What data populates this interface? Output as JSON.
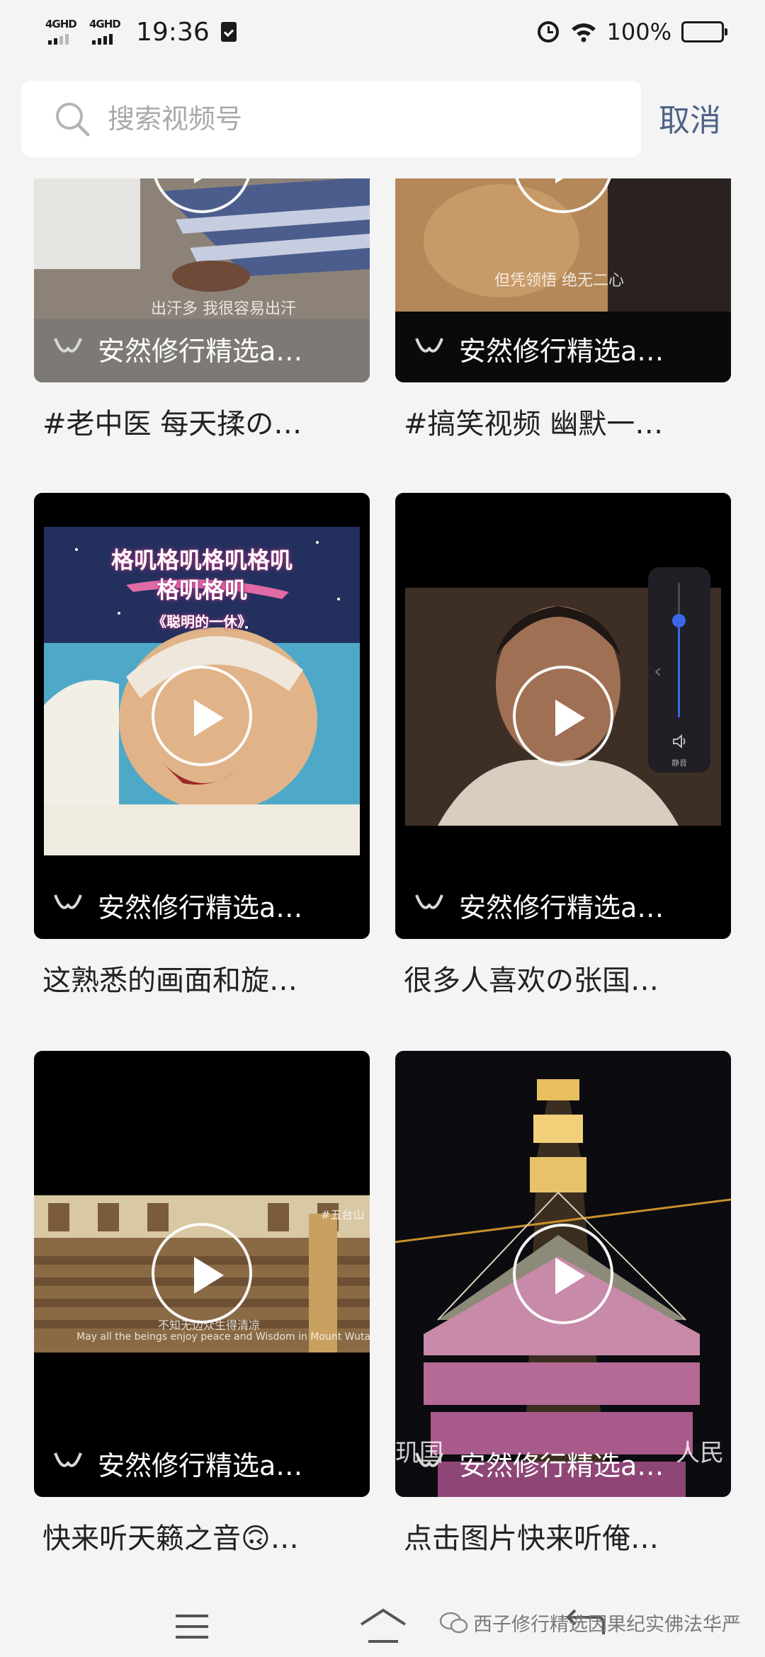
{
  "status_bar": {
    "network_1": "4GHD",
    "network_2": "4GHD",
    "time": "19:36",
    "battery_percent": "100%",
    "battery_level": 1.0,
    "icons": [
      "signal-icon",
      "clipboard-check-icon",
      "alarm-icon",
      "wifi-icon",
      "battery-icon"
    ]
  },
  "search": {
    "placeholder": "搜索视频号",
    "value": "",
    "cancel_label": "取消"
  },
  "results": [
    {
      "author": "安然修行精选a…",
      "title": "#老中医 每天揉の…",
      "caption": "出汗多  我很容易出汗"
    },
    {
      "author": "安然修行精选a…",
      "title": "#搞笑视频 幽默一…",
      "caption": "但凭领悟  绝无二心"
    },
    {
      "author": "安然修行精选a…",
      "title": "这熟悉的画面和旋…",
      "banner_line1": "格叽格叽格叽格叽",
      "banner_line2": "格叽格叽",
      "banner_line3": "《聪明的一休》"
    },
    {
      "author": "安然修行精选a…",
      "title": "很多人喜欢の张国…",
      "volume_label": "静音",
      "volume_level": 0.72
    },
    {
      "author": "安然修行精选a…",
      "title": "快来听天籁之音🙃…",
      "caption_cn": "不知无边众生得清凉",
      "caption_en": "May all the beings enjoy peace and Wisdom in Mount Wutai",
      "tag": "#五台山"
    },
    {
      "author": "安然修行精选a…",
      "title": "点击图片快来听俺…",
      "overlay_left": "玑国",
      "overlay_right": "人民"
    }
  ],
  "watermark": {
    "text": "西子修行精选因果纪实佛法华严"
  },
  "colors": {
    "accent": "#4f6386",
    "volume": "#3a67e8",
    "background": "#f4f4f5"
  }
}
